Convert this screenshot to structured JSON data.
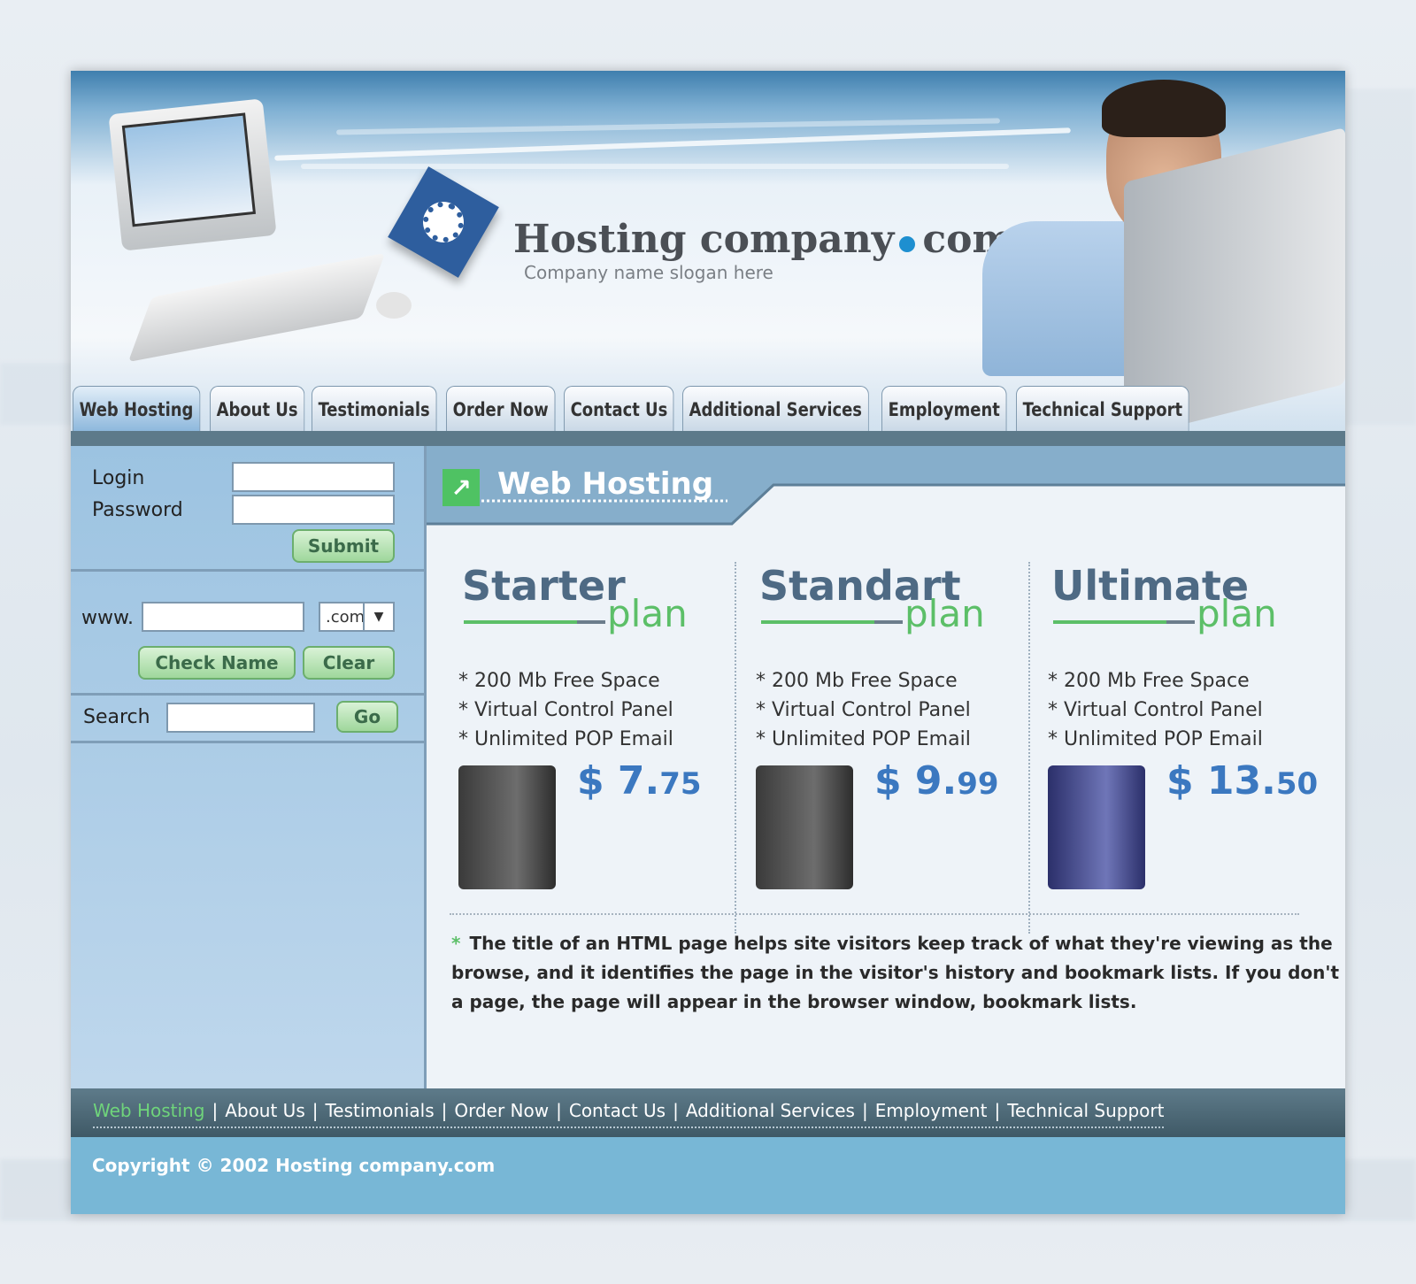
{
  "header": {
    "brand_name": "Hosting company",
    "brand_tld": "com",
    "slogan": "Company name slogan here"
  },
  "tabs": [
    {
      "label": "Web Hosting",
      "active": true
    },
    {
      "label": "About Us"
    },
    {
      "label": "Testimonials"
    },
    {
      "label": "Order Now"
    },
    {
      "label": "Contact Us"
    },
    {
      "label": "Additional Services"
    },
    {
      "label": "Employment"
    },
    {
      "label": "Technical Support"
    }
  ],
  "sidebar": {
    "login_label": "Login",
    "password_label": "Password",
    "submit_label": "Submit",
    "www_label": "www.",
    "domain_ext": ".com",
    "check_label": "Check Name",
    "clear_label": "Clear",
    "search_label": "Search",
    "go_label": "Go"
  },
  "main": {
    "title": "Web Hosting",
    "plans": [
      {
        "name": "Starter",
        "suffix": "plan",
        "features": [
          "* 200 Mb Free Space",
          "* Virtual Control Panel",
          "* Unlimited POP Email"
        ],
        "price_main": "$ 7.",
        "price_cents": "75"
      },
      {
        "name": "Standart",
        "suffix": "plan",
        "features": [
          "* 200 Mb Free Space",
          "* Virtual Control Panel",
          "* Unlimited POP Email"
        ],
        "price_main": "$ 9.",
        "price_cents": "99"
      },
      {
        "name": "Ultimate",
        "suffix": "plan",
        "features": [
          "* 200 Mb Free Space",
          "* Virtual Control Panel",
          "* Unlimited POP Email"
        ],
        "price_main": "$ 13.",
        "price_cents": "50"
      }
    ],
    "description_lines": [
      "The title of an HTML page helps site visitors keep track of what they're viewing as the",
      "browse, and it identifies the page in the visitor's history and bookmark lists. If you don't",
      "a page, the page will appear in the browser window, bookmark lists."
    ]
  },
  "footer": {
    "links": [
      "Web Hosting",
      "About Us",
      "Testimonials",
      "Order Now",
      "Contact Us",
      "Additional Services",
      "Employment",
      "Technical Support"
    ],
    "copyright": "Copyright © 2002 Hosting company.com"
  },
  "colors": {
    "accent_green": "#5cbf68",
    "price_blue": "#3b78c0",
    "sidebar_blue": "#9cc3e1",
    "footer_dark": "#4f6a78",
    "copyright_bar": "#78b7d6"
  },
  "icons": {
    "title_icon": "arrow-up-right-icon",
    "select_icon": "chevron-down-icon"
  }
}
